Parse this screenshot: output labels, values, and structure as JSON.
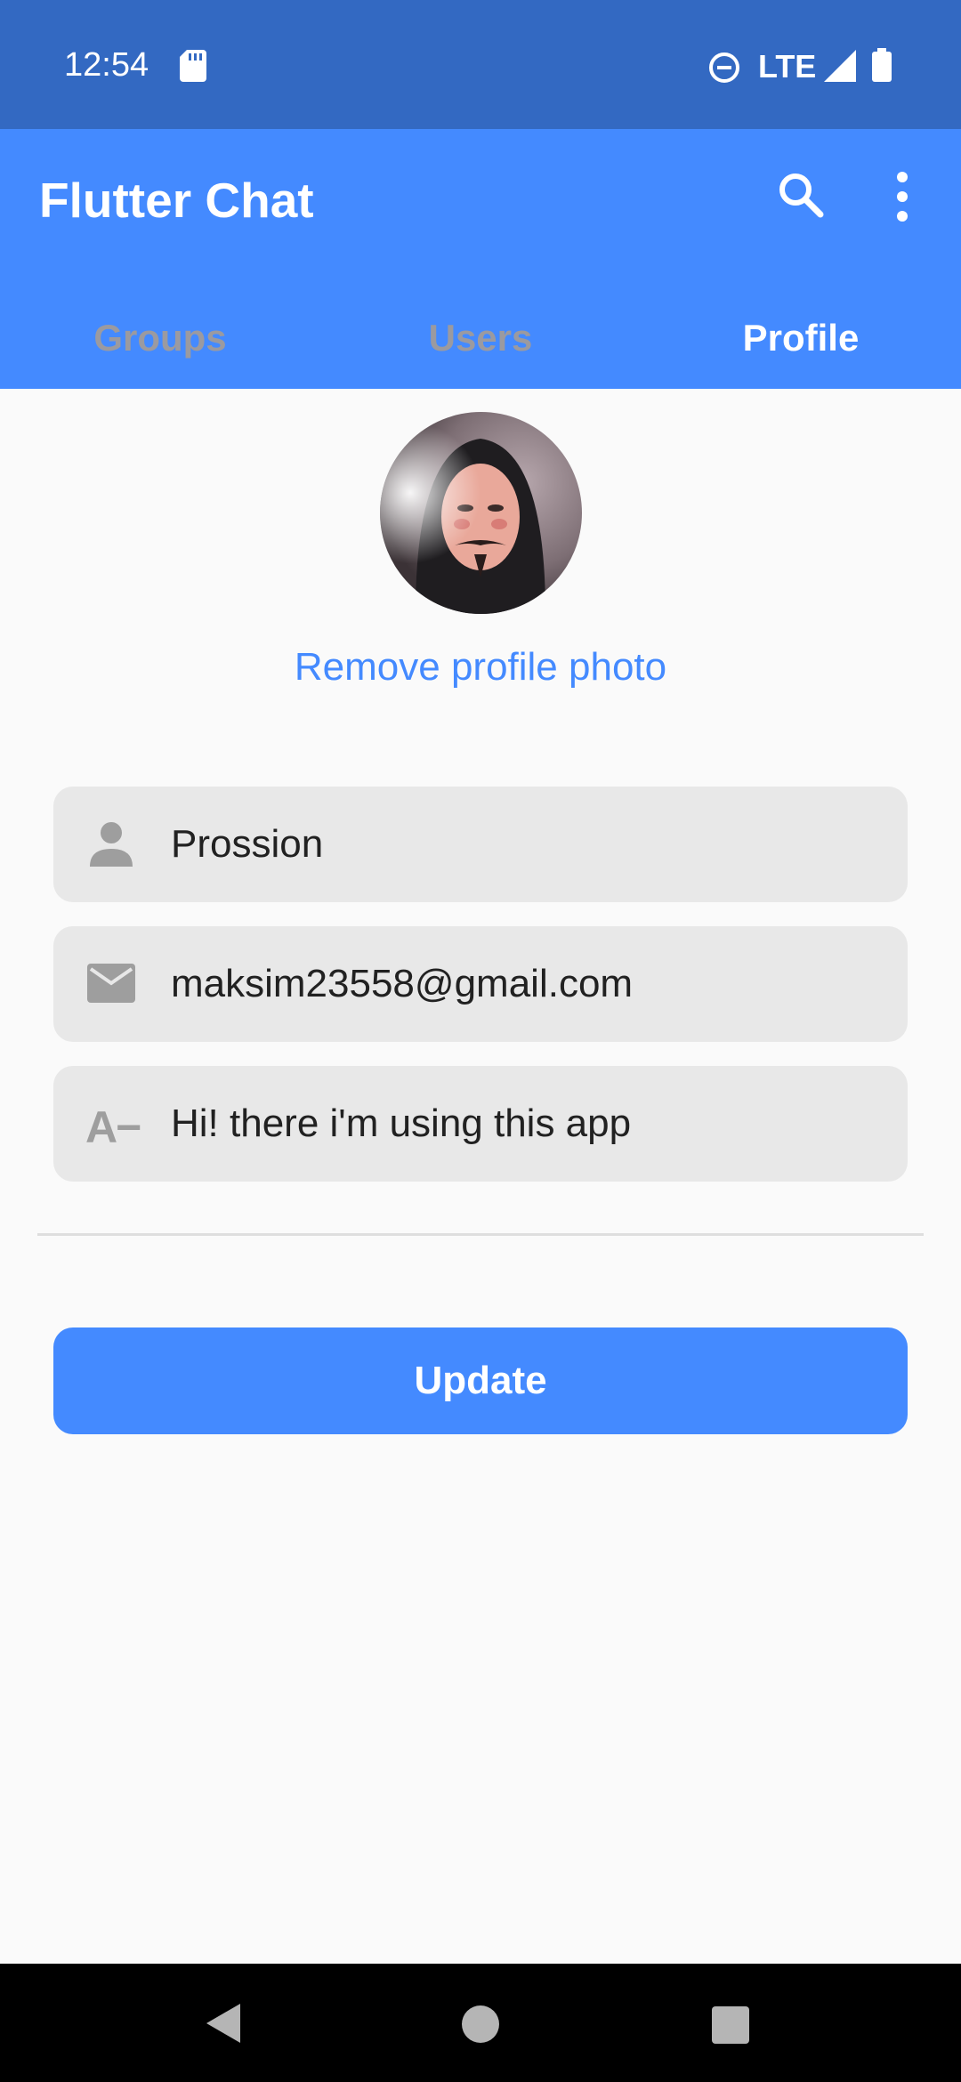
{
  "status_bar": {
    "time": "12:54",
    "network": "LTE"
  },
  "app_bar": {
    "title": "Flutter Chat",
    "icons": [
      "search-icon",
      "more-vert-icon"
    ]
  },
  "tabs": [
    {
      "label": "Groups",
      "selected": false
    },
    {
      "label": "Users",
      "selected": false
    },
    {
      "label": "Profile",
      "selected": true
    }
  ],
  "profile": {
    "remove_photo_label": "Remove profile photo",
    "fields": {
      "name": {
        "icon": "person-icon",
        "value": "Prossion"
      },
      "email": {
        "icon": "mail-icon",
        "value": "maksim23558@gmail.com"
      },
      "status": {
        "icon": "text-format-icon",
        "icon_text": "A−",
        "value": "Hi! there i'm using this app"
      }
    },
    "update_label": "Update"
  },
  "colors": {
    "status_bar": "#3369c2",
    "primary": "#448aff",
    "inactive_tab": "#9b9aa0",
    "field_bg": "#e8e8e8",
    "background": "#fafafa"
  }
}
